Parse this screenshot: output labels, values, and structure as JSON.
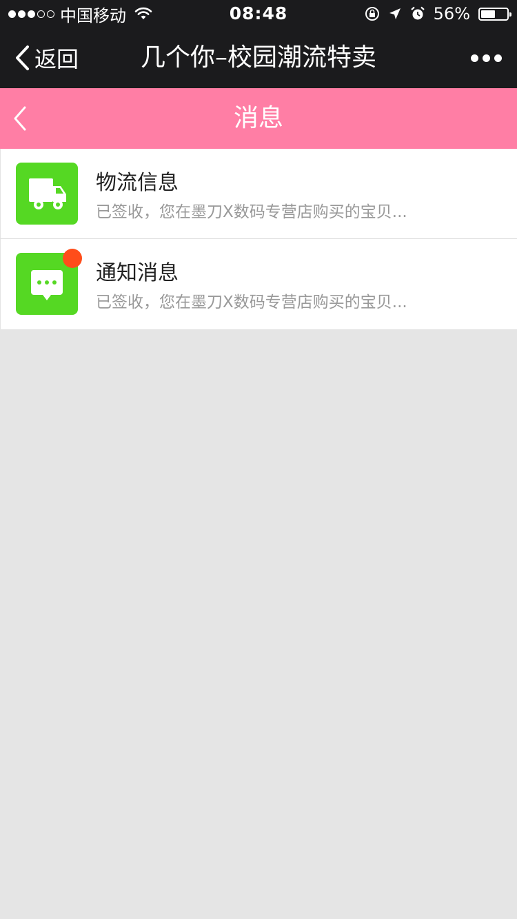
{
  "status_bar": {
    "signal_dots_filled": 3,
    "signal_dots_total": 5,
    "carrier": "中国移动",
    "time": "08:48",
    "battery_percent_text": "56%",
    "battery_level": 0.56
  },
  "nav": {
    "back_label": "返回",
    "title": "几个你–校园潮流特卖"
  },
  "header": {
    "title": "消息"
  },
  "colors": {
    "pink": "#ff7ea5",
    "icon_green": "#55d823",
    "badge_red": "#ff4d1a"
  },
  "messages": [
    {
      "icon": "truck-icon",
      "title": "物流信息",
      "preview": "已签收，您在墨刀X数码专营店购买的宝贝...",
      "unread": false
    },
    {
      "icon": "chat-bubble-icon",
      "title": "通知消息",
      "preview": "已签收，您在墨刀X数码专营店购买的宝贝...",
      "unread": true
    }
  ]
}
